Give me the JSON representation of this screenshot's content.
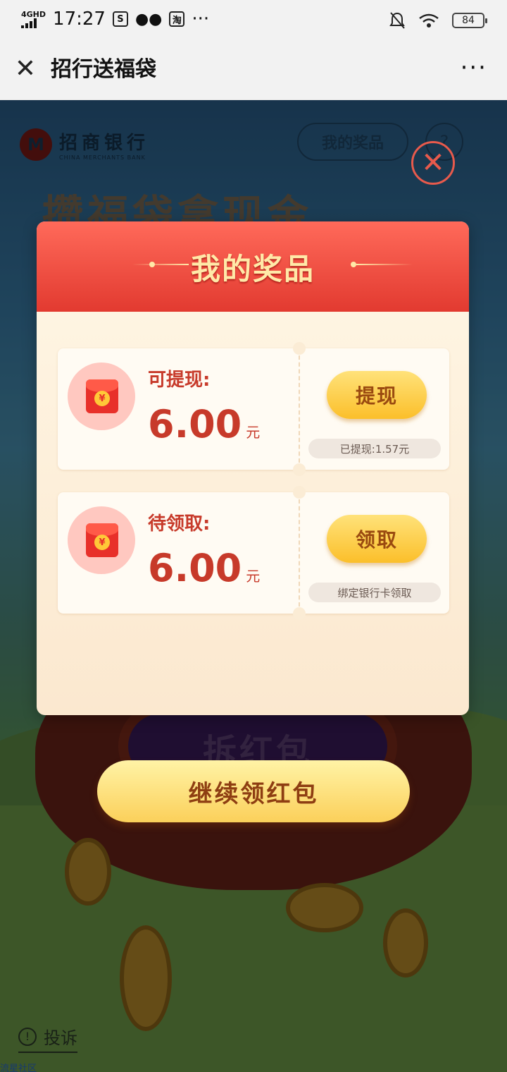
{
  "status_bar": {
    "network": "4GHD",
    "time": "17:27",
    "app_icons": [
      "s-icon",
      "wechat-icon",
      "taobao-icon"
    ],
    "taobao_glyph": "淘",
    "more_dots": "···",
    "battery": "84"
  },
  "title_bar": {
    "close_glyph": "✕",
    "title": "招行送福袋",
    "more_glyph": "···"
  },
  "background": {
    "logo_cn": "招商银行",
    "logo_en": "CHINA MERCHANTS BANK",
    "my_prizes_button": "我的奖品",
    "help_button": "?",
    "banner": "攒福袋拿现金",
    "open_button": "拆红包",
    "complain_link": "投诉",
    "watermark": "流星社区"
  },
  "modal": {
    "close_glyph": "✕",
    "title": "我的奖品",
    "cards": [
      {
        "label": "可提现:",
        "amount": "6.00",
        "unit": "元",
        "button": "提现",
        "note": "已提现:1.57元"
      },
      {
        "label": "待领取:",
        "amount": "6.00",
        "unit": "元",
        "button": "领取",
        "note": "绑定银行卡领取"
      }
    ]
  },
  "continue_button": "继续领红包",
  "colors": {
    "header_red": "#e23a30",
    "title_gold": "#ffe9a8",
    "amount_red": "#c73a2a",
    "button_gold": "#fbbf2a"
  }
}
